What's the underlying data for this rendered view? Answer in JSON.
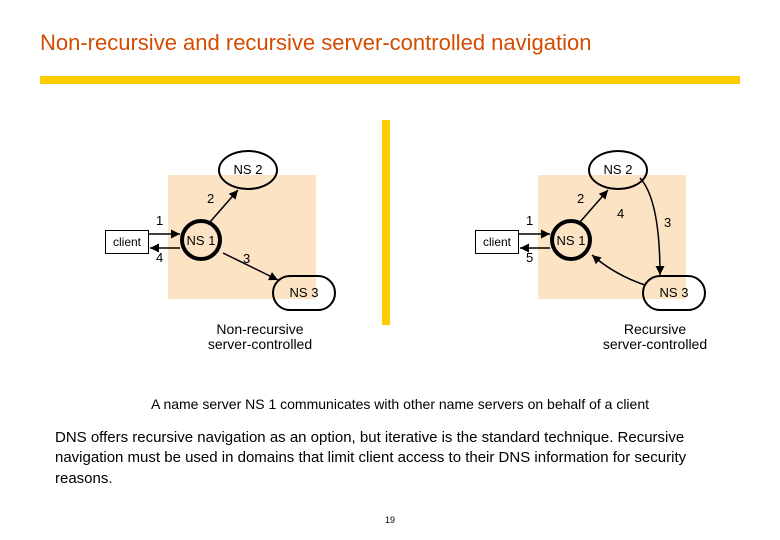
{
  "title": "Non-recursive and recursive server-controlled navigation",
  "left": {
    "ns2": "NS 2",
    "ns1": "NS 1",
    "ns3": "NS 3",
    "client": "client",
    "n1": "1",
    "n2": "2",
    "n3": "3",
    "n4": "4",
    "caption": "Non-recursive\nserver-controlled"
  },
  "right": {
    "ns2": "NS 2",
    "ns1": "NS 1",
    "ns3": "NS 3",
    "client": "client",
    "n1": "1",
    "n2": "2",
    "n3": "3",
    "n4": "4",
    "n5": "5",
    "caption": "Recursive\nserver-controlled"
  },
  "subtitle": "A name server NS 1 communicates with other name servers on behalf of a client",
  "paragraph": "DNS offers recursive navigation as an option, but iterative is the standard technique. Recursive navigation must be used in domains that limit client access to their DNS information for security reasons.",
  "page": "19"
}
